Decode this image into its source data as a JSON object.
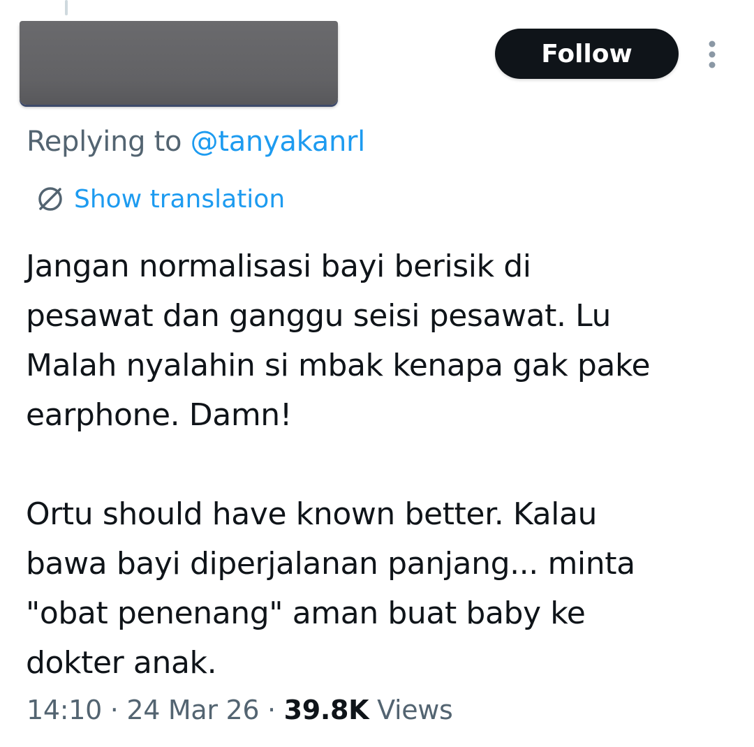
{
  "header": {
    "follow_label": "Follow",
    "more_icon": "more-vertical-icon"
  },
  "reply": {
    "prefix": "Replying to",
    "handle": "@tanyakanrl"
  },
  "translation": {
    "icon": "globe-icon",
    "label": "Show translation"
  },
  "tweet": {
    "paragraph_1": "Jangan normalisasi bayi berisik di\npesawat dan ganggu seisi pesawat. Lu\nMalah nyalahin si mbak kenapa gak pake\nearphone. Damn!",
    "paragraph_2": "Ortu should have known better. Kalau\nbawa bayi diperjalanan panjang... minta\n\"obat penenang\" aman buat baby ke\ndokter anak."
  },
  "meta": {
    "time": "14:10",
    "separator": "·",
    "date": "24 Mar 26",
    "views_count": "39.8K",
    "views_label": "Views"
  },
  "colors": {
    "accent": "#1d9bf0",
    "text_primary": "#0f1419",
    "text_secondary": "#536471",
    "button_bg": "#0f1419"
  }
}
